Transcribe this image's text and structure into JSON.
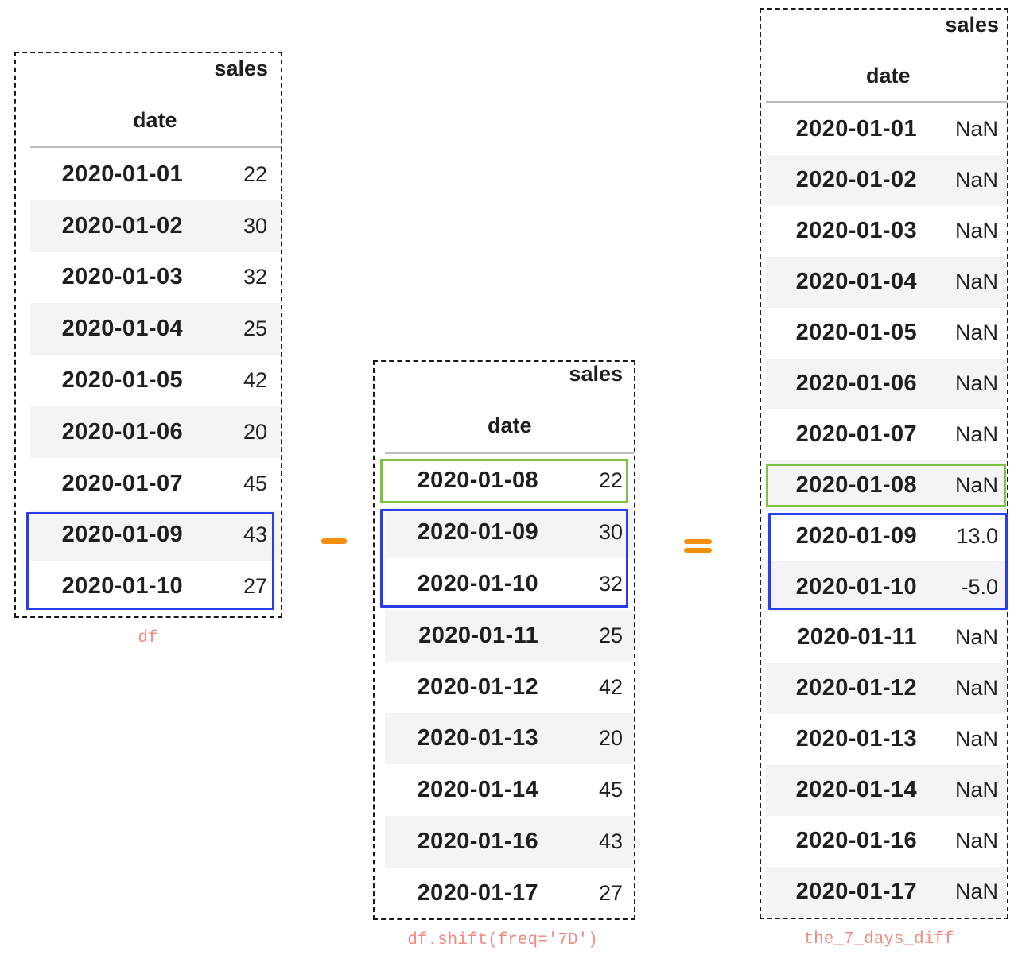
{
  "colors": {
    "highlight_green": "#7cc242",
    "highlight_blue": "#2b3cf0",
    "operator": "#f5900f",
    "caption": "#f08a80",
    "stripe": "#f4f4f4"
  },
  "operators": {
    "minus": "minus",
    "equals": "equals"
  },
  "tables": [
    {
      "id": "df",
      "caption": "df",
      "column_header": "sales",
      "index_header": "date",
      "rows": [
        {
          "date": "2020-01-01",
          "sales": "22"
        },
        {
          "date": "2020-01-02",
          "sales": "30"
        },
        {
          "date": "2020-01-03",
          "sales": "32"
        },
        {
          "date": "2020-01-04",
          "sales": "25"
        },
        {
          "date": "2020-01-05",
          "sales": "42"
        },
        {
          "date": "2020-01-06",
          "sales": "20"
        },
        {
          "date": "2020-01-07",
          "sales": "45"
        },
        {
          "date": "2020-01-09",
          "sales": "43"
        },
        {
          "date": "2020-01-10",
          "sales": "27"
        }
      ],
      "highlights": [
        {
          "color": "blue",
          "rows": [
            "2020-01-09",
            "2020-01-10"
          ]
        }
      ]
    },
    {
      "id": "shifted",
      "caption": "df.shift(freq='7D')",
      "column_header": "sales",
      "index_header": "date",
      "rows": [
        {
          "date": "2020-01-08",
          "sales": "22"
        },
        {
          "date": "2020-01-09",
          "sales": "30"
        },
        {
          "date": "2020-01-10",
          "sales": "32"
        },
        {
          "date": "2020-01-11",
          "sales": "25"
        },
        {
          "date": "2020-01-12",
          "sales": "42"
        },
        {
          "date": "2020-01-13",
          "sales": "20"
        },
        {
          "date": "2020-01-14",
          "sales": "45"
        },
        {
          "date": "2020-01-16",
          "sales": "43"
        },
        {
          "date": "2020-01-17",
          "sales": "27"
        }
      ],
      "highlights": [
        {
          "color": "green",
          "rows": [
            "2020-01-08"
          ]
        },
        {
          "color": "blue",
          "rows": [
            "2020-01-09",
            "2020-01-10"
          ]
        }
      ]
    },
    {
      "id": "diff",
      "caption": "the_7_days_diff",
      "column_header": "sales",
      "index_header": "date",
      "rows": [
        {
          "date": "2020-01-01",
          "sales": "NaN"
        },
        {
          "date": "2020-01-02",
          "sales": "NaN"
        },
        {
          "date": "2020-01-03",
          "sales": "NaN"
        },
        {
          "date": "2020-01-04",
          "sales": "NaN"
        },
        {
          "date": "2020-01-05",
          "sales": "NaN"
        },
        {
          "date": "2020-01-06",
          "sales": "NaN"
        },
        {
          "date": "2020-01-07",
          "sales": "NaN"
        },
        {
          "date": "2020-01-08",
          "sales": "NaN"
        },
        {
          "date": "2020-01-09",
          "sales": "13.0"
        },
        {
          "date": "2020-01-10",
          "sales": "-5.0"
        },
        {
          "date": "2020-01-11",
          "sales": "NaN"
        },
        {
          "date": "2020-01-12",
          "sales": "NaN"
        },
        {
          "date": "2020-01-13",
          "sales": "NaN"
        },
        {
          "date": "2020-01-14",
          "sales": "NaN"
        },
        {
          "date": "2020-01-16",
          "sales": "NaN"
        },
        {
          "date": "2020-01-17",
          "sales": "NaN"
        }
      ],
      "highlights": [
        {
          "color": "green",
          "rows": [
            "2020-01-08"
          ]
        },
        {
          "color": "blue",
          "rows": [
            "2020-01-09",
            "2020-01-10"
          ]
        }
      ]
    }
  ]
}
